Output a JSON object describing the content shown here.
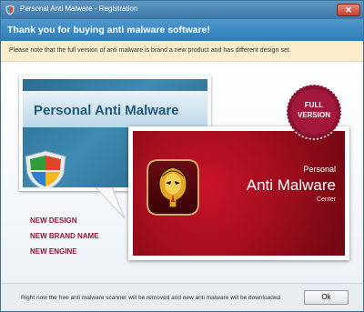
{
  "window": {
    "title": "Personal Anti Malware - Registration",
    "close_glyph": "✕"
  },
  "header": {
    "title": "Thank you for buying anti malware software!"
  },
  "note": {
    "text": "Please note that the full version of anti malware is brand a new product and has different design set."
  },
  "old_product": {
    "title": "Personal Anti Malware",
    "icon": "shield-icon"
  },
  "features": [
    "NEW DESIGN",
    "NEW BRAND NAME",
    "NEW ENGINE"
  ],
  "new_product": {
    "line1": "Personal",
    "line2": "Anti Malware",
    "line3": "Center",
    "icon": "cobra-icon"
  },
  "seal": {
    "line1": "FULL",
    "line2": "VERSION"
  },
  "footer": {
    "text": "Right now the free anti malware scanner will be removed and new anti malware will be downloaded",
    "ok_label": "Ok"
  },
  "colors": {
    "titlebar": "#3d78a8",
    "header": "#2f7db8",
    "note_background": "#fbeccb",
    "feature_text": "#9b1235",
    "new_product_background": "#a40e1e",
    "seal": "#8b1332"
  }
}
